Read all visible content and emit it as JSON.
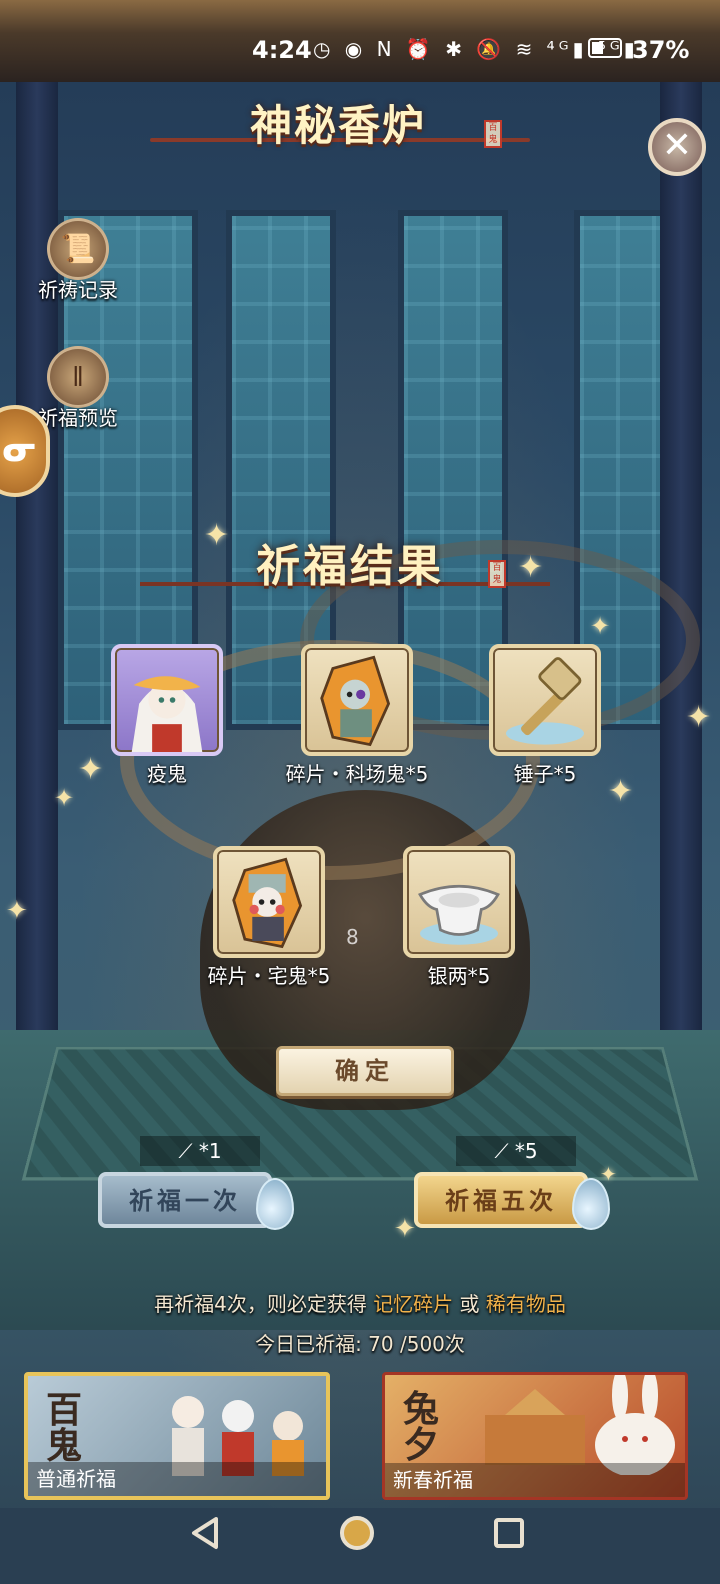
{
  "status_bar": {
    "time": "4:24",
    "icons": "◷ ◉ N ⏰ ✱ 🔕 ≋ ⁴ᴳ▮ ⁵ᴳ▮",
    "battery_percent": "37%"
  },
  "header": {
    "title": "神秘香炉",
    "seal": "百鬼"
  },
  "side_menu": {
    "items": [
      {
        "label": "祈祷记录",
        "icon": "scroll-icon"
      },
      {
        "label": "祈福预览",
        "icon": "incense-icon"
      }
    ]
  },
  "result": {
    "title": "祈福结果",
    "seal": "百鬼",
    "items": [
      {
        "name": "疫鬼",
        "rarity": "purple"
      },
      {
        "name": "碎片・科场鬼*5",
        "rarity": "gold"
      },
      {
        "name": "锤子*5",
        "rarity": "gold"
      },
      {
        "name": "碎片・宅鬼*5",
        "rarity": "gold"
      },
      {
        "name": "银两*5",
        "rarity": "gold"
      }
    ],
    "overlay_count": "8",
    "confirm_label": "确定"
  },
  "pray": {
    "once": {
      "label": "祈福一次",
      "cost": "*1"
    },
    "five": {
      "label": "祈福五次",
      "cost": "*5"
    }
  },
  "hint": {
    "prefix": "再祈福4次，则必定获得",
    "item1": "记忆碎片",
    "or": "或",
    "item2": "稀有物品",
    "today": "今日已祈福: 70 /500次"
  },
  "pools": {
    "normal": {
      "badge": "百鬼",
      "label": "普通祈福"
    },
    "spring": {
      "badge": "兔夕",
      "label": "新春祈福"
    }
  },
  "colors": {
    "highlight": "#f2b24a",
    "gold_button": "#c99a45",
    "silver_button": "#6f879c"
  }
}
